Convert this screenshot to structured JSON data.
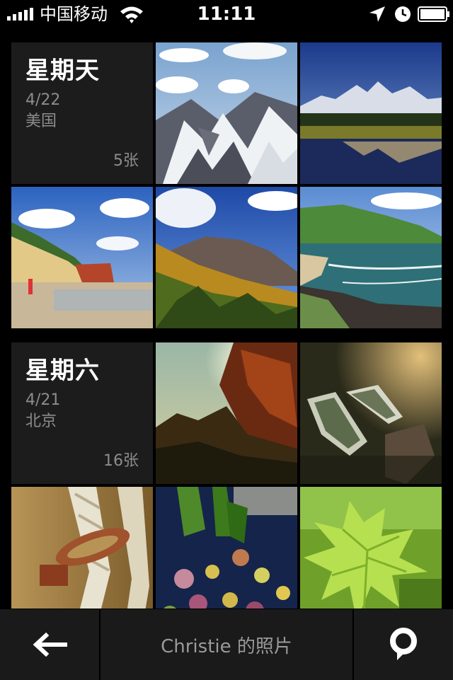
{
  "status_bar": {
    "carrier": "中国移动",
    "time": "11:11"
  },
  "days": [
    {
      "title": "星期天",
      "date": "4/22",
      "place": "美国",
      "count": "5张"
    },
    {
      "title": "星期六",
      "date": "4/21",
      "place": "北京",
      "count": "16张"
    }
  ],
  "photos": [
    {
      "subject": "snowy-mountains-aerial"
    },
    {
      "subject": "mountain-lake-reflection"
    },
    {
      "subject": "beach-red-cliffs"
    },
    {
      "subject": "autumn-mountain-valley"
    },
    {
      "subject": "coastal-bay"
    },
    {
      "subject": "sunlit-trees"
    },
    {
      "subject": "rowboats-on-water"
    },
    {
      "subject": "rope-and-hook"
    },
    {
      "subject": "lily-pads-pond"
    },
    {
      "subject": "green-leaf"
    }
  ],
  "toolbar": {
    "title": "Christie 的照片",
    "back_icon": "back-arrow-icon",
    "map_icon": "map-pin-icon"
  },
  "colors": {
    "background": "#000000",
    "card": "#1c1c1c",
    "toolbar": "#1a1a1a",
    "muted_text": "#8c8c8c"
  }
}
